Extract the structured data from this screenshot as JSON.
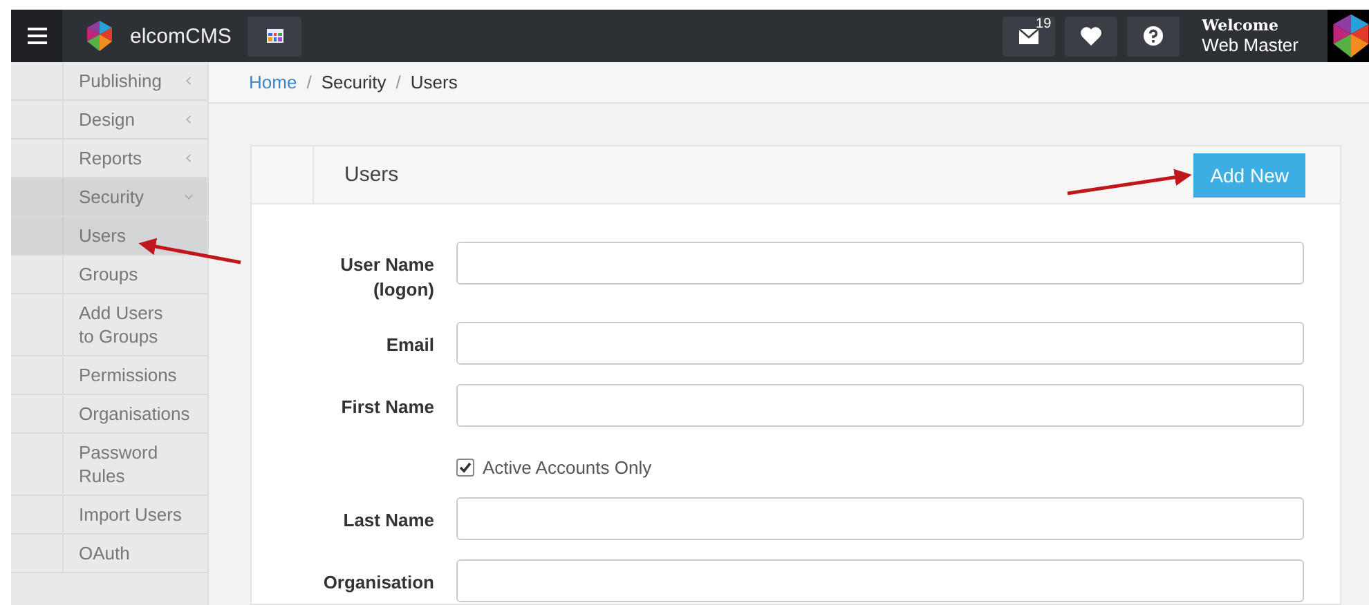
{
  "topbar": {
    "brand": "elcomCMS",
    "messages_count": "19",
    "welcome": "Welcome",
    "user_name": "Web Master"
  },
  "sidebar": {
    "items": [
      {
        "label": "Publishing",
        "expanded": false
      },
      {
        "label": "Design",
        "expanded": false
      },
      {
        "label": "Reports",
        "expanded": false
      },
      {
        "label": "Security",
        "expanded": true,
        "children": [
          {
            "label": "Users",
            "selected": true
          },
          {
            "label": "Groups",
            "selected": false
          },
          {
            "label": "Add Users to Groups",
            "selected": false
          },
          {
            "label": "Permissions",
            "selected": false
          },
          {
            "label": "Organisations",
            "selected": false
          },
          {
            "label": "Password Rules",
            "selected": false
          },
          {
            "label": "Import Users",
            "selected": false
          },
          {
            "label": "OAuth",
            "selected": false
          }
        ]
      }
    ]
  },
  "breadcrumb": [
    {
      "label": "Home",
      "kind": "link"
    },
    {
      "label": "/",
      "kind": "separator"
    },
    {
      "label": "Security",
      "kind": "text"
    },
    {
      "label": "/",
      "kind": "separator"
    },
    {
      "label": "Users",
      "kind": "text"
    }
  ],
  "panel": {
    "title": "Users",
    "add_button": "Add New",
    "fields": [
      {
        "kind": "text",
        "label": "User Name (logon)"
      },
      {
        "kind": "text",
        "label": "Email"
      },
      {
        "kind": "text",
        "label": "First Name"
      },
      {
        "kind": "checkbox",
        "label": "Active Accounts Only",
        "checked": true
      },
      {
        "kind": "text",
        "label": "Last Name"
      },
      {
        "kind": "text",
        "label": "Organisation"
      }
    ]
  }
}
